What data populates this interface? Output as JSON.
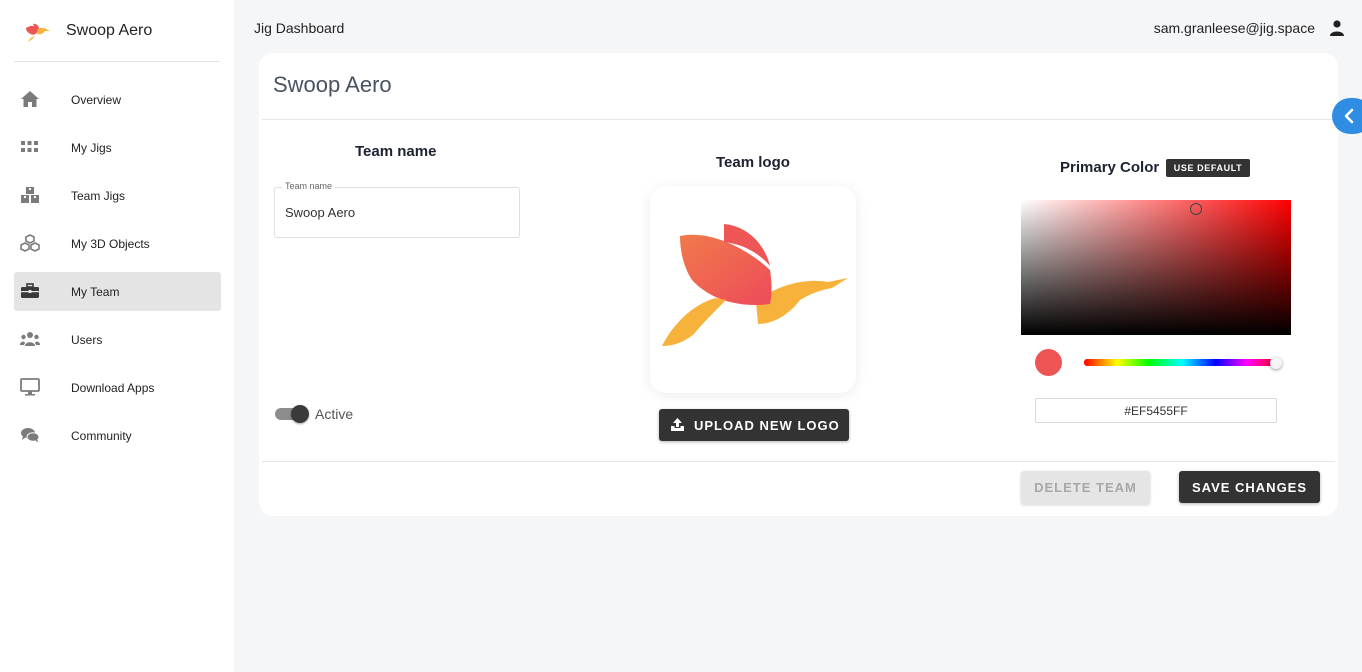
{
  "brand": {
    "name": "Swoop Aero",
    "logo_icon": "swoop-bird-logo"
  },
  "topbar": {
    "title": "Jig Dashboard",
    "user_email": "sam.granleese@jig.space",
    "user_icon": "user-icon"
  },
  "sidebar": {
    "items": [
      {
        "label": "Overview",
        "icon": "home-icon",
        "active": false
      },
      {
        "label": "My Jigs",
        "icon": "grid-icon",
        "active": false
      },
      {
        "label": "Team Jigs",
        "icon": "boxes-icon",
        "active": false
      },
      {
        "label": "My 3D Objects",
        "icon": "cubes-icon",
        "active": false
      },
      {
        "label": "My Team",
        "icon": "briefcase-icon",
        "active": true
      },
      {
        "label": "Users",
        "icon": "users-icon",
        "active": false
      },
      {
        "label": "Download Apps",
        "icon": "desktop-icon",
        "active": false
      },
      {
        "label": "Community",
        "icon": "chat-icon",
        "active": false
      }
    ]
  },
  "team": {
    "title": "Swoop Aero",
    "name_heading": "Team name",
    "name_field_label": "Team name",
    "name_value": "Swoop Aero",
    "active_label": "Active",
    "active": true,
    "logo_heading": "Team logo",
    "upload_label": "UPLOAD NEW LOGO",
    "color_heading": "Primary Color",
    "use_default_label": "USE DEFAULT",
    "hex_value": "#EF5455FF",
    "color": "#EF5455",
    "delete_label": "DELETE TEAM",
    "save_label": "SAVE CHANGES"
  }
}
